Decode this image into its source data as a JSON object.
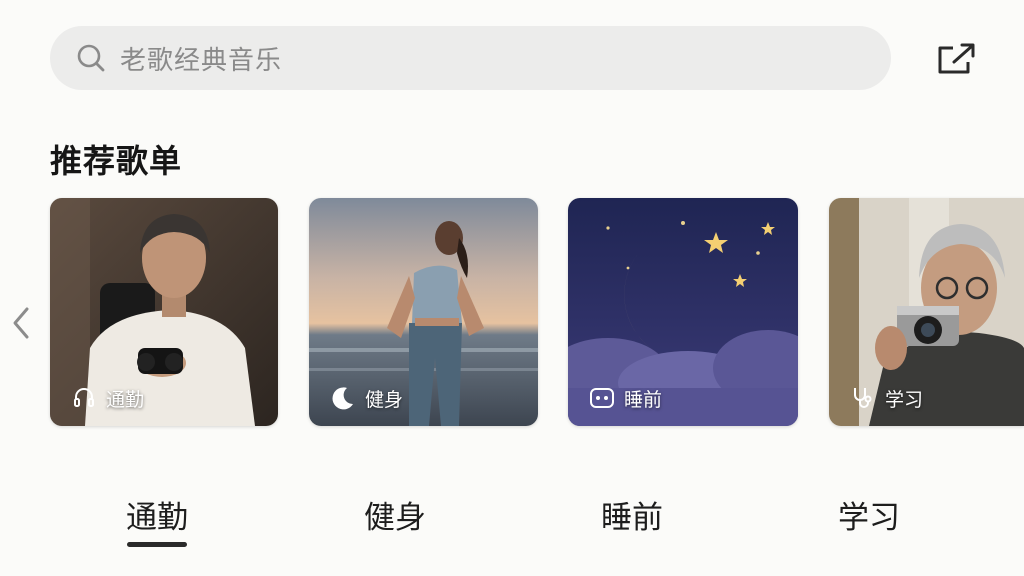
{
  "search": {
    "placeholder": "老歌经典音乐"
  },
  "section": {
    "title": "推荐歌单"
  },
  "cards": [
    {
      "tag": "通勤",
      "icon": "headset-icon"
    },
    {
      "tag": "健身",
      "icon": "moon-icon"
    },
    {
      "tag": "睡前",
      "icon": "robot-icon"
    },
    {
      "tag": "学习",
      "icon": "stethoscope-icon"
    }
  ],
  "tabs": [
    {
      "label": "通勤",
      "active": true
    },
    {
      "label": "健身",
      "active": false
    },
    {
      "label": "睡前",
      "active": false
    },
    {
      "label": "学习",
      "active": false
    }
  ],
  "colors": {
    "background": "#fbfbf9",
    "search_bg": "#ececeb",
    "accent": "#2a2a2a"
  }
}
